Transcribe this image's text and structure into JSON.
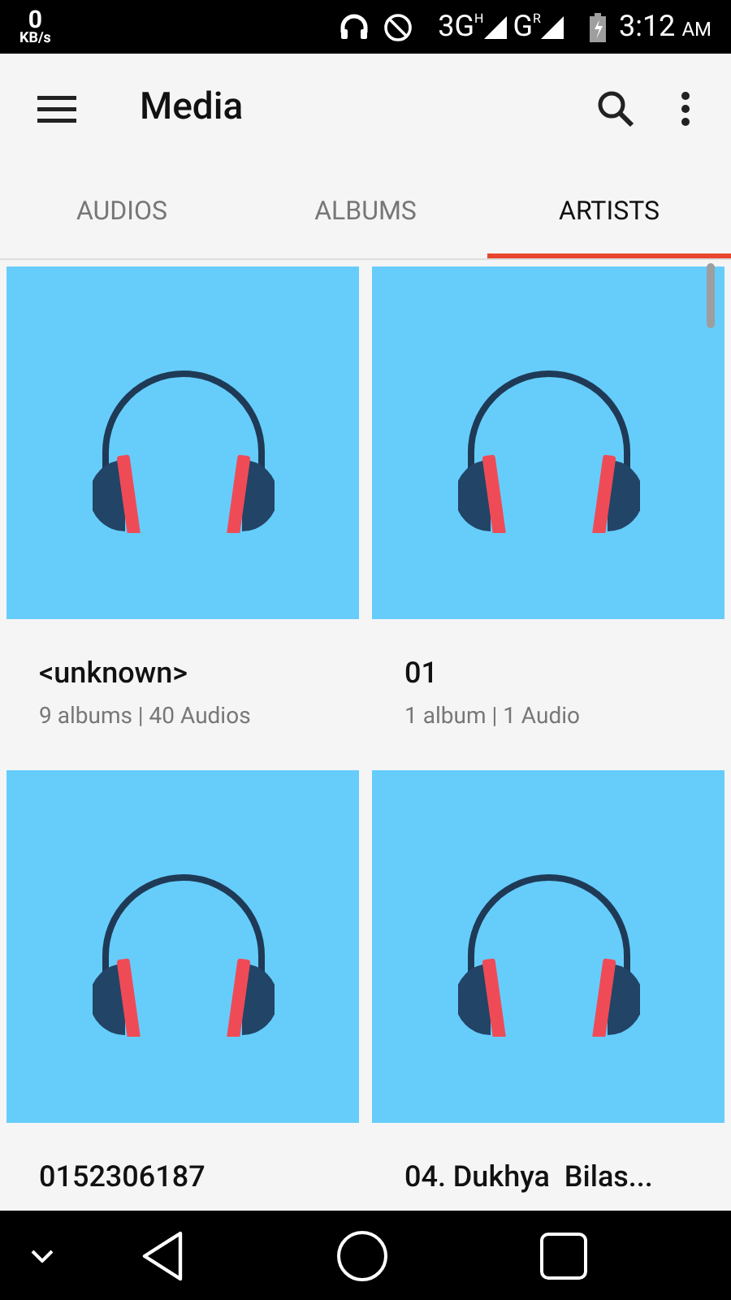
{
  "status_bar": {
    "speed_value": "0",
    "speed_unit": "KB/s",
    "network_1": "3G",
    "network_1_type": "H",
    "network_2": "G",
    "network_2_type": "R",
    "time": "3:12",
    "time_suffix": "AM"
  },
  "app_bar": {
    "title": "Media"
  },
  "tabs": [
    {
      "label": "AUDIOS",
      "selected": false
    },
    {
      "label": "ALBUMS",
      "selected": false
    },
    {
      "label": "ARTISTS",
      "selected": true
    }
  ],
  "artists": [
    {
      "name": "<unknown>",
      "details": "9 albums | 40 Audios"
    },
    {
      "name": "01",
      "details": "1 album | 1 Audio"
    },
    {
      "name": "0152306187"
    },
    {
      "name": "04. Dukhya  Bilas..."
    }
  ]
}
